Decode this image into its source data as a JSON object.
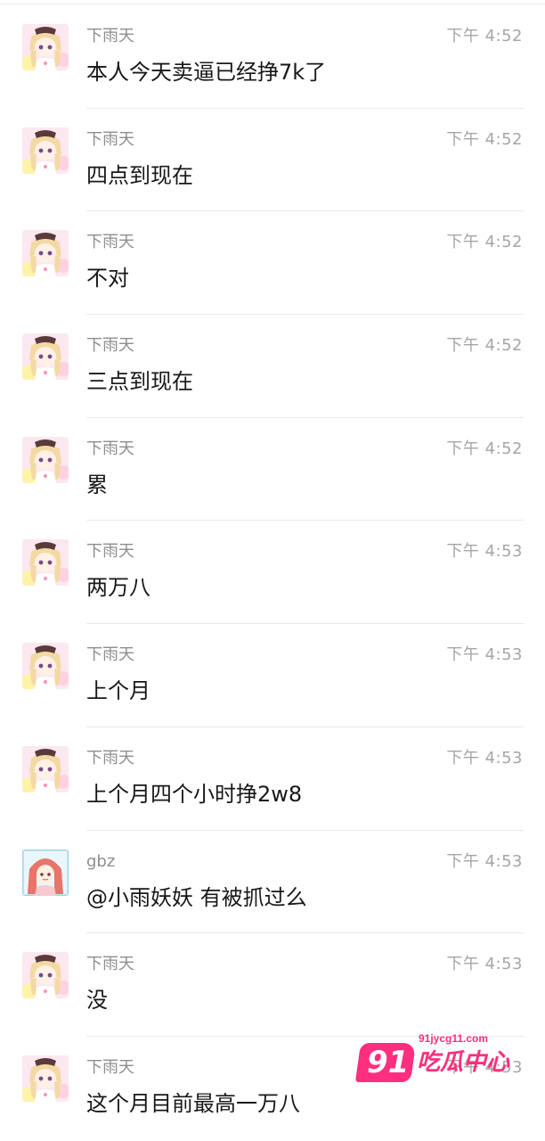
{
  "messages": [
    {
      "sender": "下雨天",
      "time": "下午 4:52",
      "text": "本人今天卖逼已经挣7k了",
      "avatar": "anime-girl-avatar"
    },
    {
      "sender": "下雨天",
      "time": "下午 4:52",
      "text": "四点到现在",
      "avatar": "anime-girl-avatar"
    },
    {
      "sender": "下雨天",
      "time": "下午 4:52",
      "text": "不对",
      "avatar": "anime-girl-avatar"
    },
    {
      "sender": "下雨天",
      "time": "下午 4:52",
      "text": "三点到现在",
      "avatar": "anime-girl-avatar"
    },
    {
      "sender": "下雨天",
      "time": "下午 4:52",
      "text": "累",
      "avatar": "anime-girl-avatar"
    },
    {
      "sender": "下雨天",
      "time": "下午 4:53",
      "text": "两万八",
      "avatar": "anime-girl-avatar"
    },
    {
      "sender": "下雨天",
      "time": "下午 4:53",
      "text": "上个月",
      "avatar": "anime-girl-avatar"
    },
    {
      "sender": "下雨天",
      "time": "下午 4:53",
      "text": "上个月四个小时挣2w8",
      "avatar": "anime-girl-avatar"
    },
    {
      "sender": "gbz",
      "time": "下午 4:53",
      "text": "@小雨妖妖 有被抓过么",
      "avatar": "red-hair-girl-avatar"
    },
    {
      "sender": "下雨天",
      "time": "下午 4:53",
      "text": "没",
      "avatar": "anime-girl-avatar"
    },
    {
      "sender": "下雨天",
      "time": "下午 4:53",
      "text": "这个月目前最高一万八",
      "avatar": "anime-girl-avatar"
    }
  ],
  "watermark": {
    "number": "91",
    "domain": "91jycg11.com",
    "brand": "吃瓜中心"
  },
  "colors": {
    "name": "#8e8e8e",
    "time": "#a6a6a6",
    "divider": "#e9e9e9",
    "watermark": "#ff2e7e"
  }
}
